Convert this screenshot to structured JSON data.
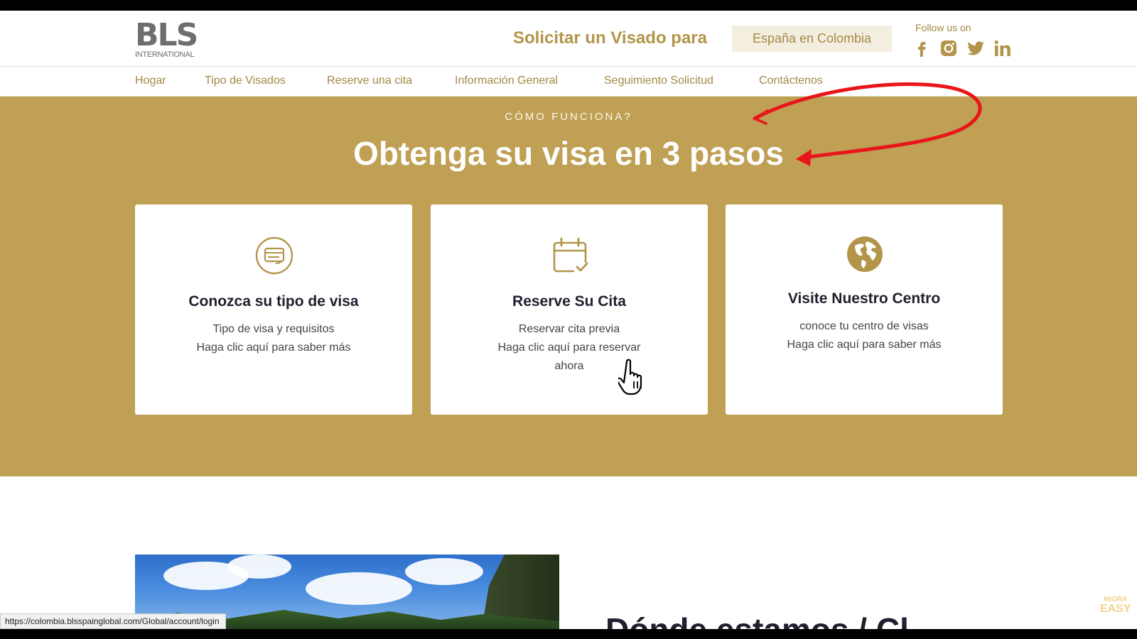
{
  "brand": {
    "logo_text": "BLS",
    "logo_subtext": "INTERNATIONAL"
  },
  "header": {
    "visa_title": "Solicitar un Visado para",
    "country_button": "España en Colombia",
    "follow_label": "Follow us on"
  },
  "nav": {
    "items": [
      {
        "label": "Hogar"
      },
      {
        "label": "Tipo de Visados"
      },
      {
        "label": "Reserve una cita"
      },
      {
        "label": "Información General"
      },
      {
        "label": "Seguimiento Solicitud"
      },
      {
        "label": "Contáctenos"
      }
    ]
  },
  "hero": {
    "eyebrow": "CÓMO FUNCIONA?",
    "headline": "Obtenga su visa en 3 pasos"
  },
  "cards": [
    {
      "title": "Conozca su tipo de visa",
      "line1": "Tipo de visa y requisitos",
      "line2": "Haga clic aquí para saber más",
      "line3": ""
    },
    {
      "title": "Reserve Su Cita",
      "line1": "Reservar cita previa",
      "line2": "Haga clic aquí para reservar",
      "line3": "ahora"
    },
    {
      "title": "Visite Nuestro Centro",
      "line1": "conoce tu centro de visas",
      "line2": "Haga clic aquí para saber más",
      "line3": ""
    }
  ],
  "next_section": {
    "heading": "Dónde estamos / Cl"
  },
  "status_bar": {
    "url": "https://colombia.blsspainglobal.com/Global/account/login"
  },
  "watermark": {
    "top": "MIGRA",
    "bottom": "EASY"
  },
  "colors": {
    "gold": "#bfa054",
    "gold_text": "#a48845",
    "annotation_red": "#e8161a"
  },
  "icons": {
    "card1": "id-card-icon",
    "card2": "calendar-check-icon",
    "card3": "globe-icon",
    "social": [
      "facebook-icon",
      "instagram-icon",
      "twitter-icon",
      "linkedin-icon"
    ]
  }
}
